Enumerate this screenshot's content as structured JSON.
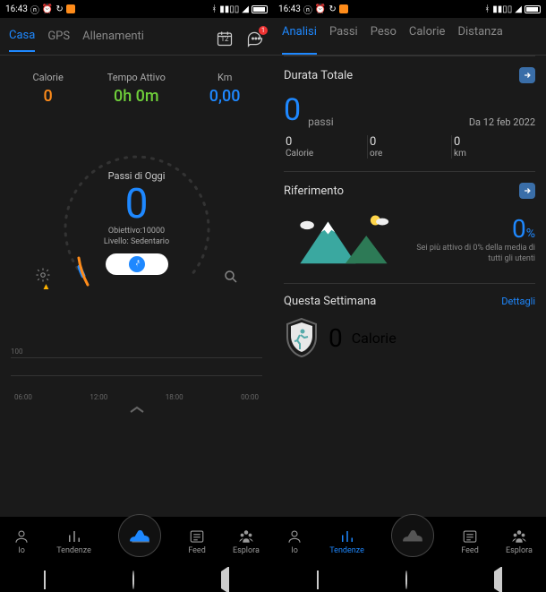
{
  "status": {
    "time": "16:43",
    "battery": "86"
  },
  "left": {
    "tabs": [
      "Casa",
      "GPS",
      "Allenamenti"
    ],
    "activeTab": 0,
    "cal_date": "12",
    "chat_badge": "1",
    "triple": {
      "calorie_label": "Calorie",
      "calorie_value": "0",
      "time_label": "Tempo Attivo",
      "time_value": "0h 0m",
      "km_label": "Km",
      "km_value": "0,00"
    },
    "gauge": {
      "title": "Passi di Oggi",
      "value": "0",
      "goal_label": "Obiettivo:10000",
      "level_label": "Livello: Sedentario"
    },
    "chart": {
      "y_label": "100",
      "x": [
        "06:00",
        "12:00",
        "18:00",
        "00:00"
      ]
    }
  },
  "right": {
    "tabs": [
      "Analisi",
      "Passi",
      "Peso",
      "Calorie",
      "Distanza"
    ],
    "activeTab": 0,
    "duration": {
      "title": "Durata Totale",
      "value": "0",
      "unit": "passi",
      "since": "Da 12 feb 2022",
      "cols": [
        {
          "n": "0",
          "u": "Calorie"
        },
        {
          "n": "0",
          "u": "ore"
        },
        {
          "n": "0",
          "u": "km"
        }
      ]
    },
    "reference": {
      "title": "Riferimento",
      "pct": "0",
      "pct_sym": "%",
      "desc": "Sei più attivo di 0% della media di tutti gli utenti"
    },
    "week": {
      "title": "Questa Settimana",
      "details": "Dettagli",
      "value": "0",
      "unit": "Calorie"
    }
  },
  "bottom": {
    "items": [
      "Io",
      "Tendenze",
      "",
      "Feed",
      "Esplora"
    ]
  },
  "chart_data": {
    "type": "line",
    "title": "Passi di Oggi",
    "categories": [
      "06:00",
      "12:00",
      "18:00",
      "00:00"
    ],
    "values": [
      0,
      0,
      0,
      0
    ],
    "ylim": [
      0,
      100
    ],
    "ylabel": "",
    "xlabel": ""
  }
}
